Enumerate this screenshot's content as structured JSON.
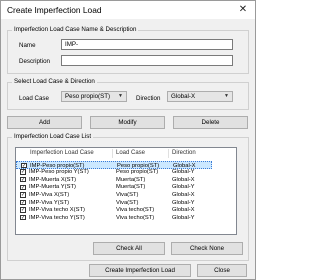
{
  "window": {
    "title": "Create Imperfection Load"
  },
  "name_group": {
    "legend": "Imperfection Load Case Name & Description",
    "name_label": "Name",
    "name_value": "IMP-",
    "description_label": "Description",
    "description_value": ""
  },
  "select_group": {
    "legend": "Select Load Case & Direction",
    "load_case_label": "Load Case",
    "load_case_value": "Peso propio(ST)",
    "direction_label": "Direction",
    "direction_value": "Global-X"
  },
  "actions": {
    "add": "Add",
    "modify": "Modify",
    "delete": "Delete"
  },
  "list_group": {
    "legend": "Imperfection Load Case List",
    "columns": [
      "Imperfection Load Case",
      "Load Case",
      "Direction"
    ],
    "rows": [
      {
        "checked": true,
        "name": "IMP-Peso propio(ST)",
        "load_case": "Peso propio(ST)",
        "direction": "Global-X",
        "selected": true
      },
      {
        "checked": true,
        "name": "IMP-Peso propio Y(ST)",
        "load_case": "Peso propio(ST)",
        "direction": "Global-Y",
        "selected": false
      },
      {
        "checked": true,
        "name": "IMP-Muerta X(ST)",
        "load_case": "Muerta(ST)",
        "direction": "Global-X",
        "selected": false
      },
      {
        "checked": true,
        "name": "IMP-Muerta Y(ST)",
        "load_case": "Muerta(ST)",
        "direction": "Global-Y",
        "selected": false
      },
      {
        "checked": true,
        "name": "IMP-Viva X(ST)",
        "load_case": "Viva(ST)",
        "direction": "Global-X",
        "selected": false
      },
      {
        "checked": true,
        "name": "IMP-Viva Y(ST)",
        "load_case": "Viva(ST)",
        "direction": "Global-Y",
        "selected": false
      },
      {
        "checked": true,
        "name": "IMP-Viva techo X(ST)",
        "load_case": "Viva techo(ST)",
        "direction": "Global-X",
        "selected": false
      },
      {
        "checked": true,
        "name": "IMP-Viva techo Y(ST)",
        "load_case": "Viva techo(ST)",
        "direction": "Global-Y",
        "selected": false
      }
    ],
    "check_all": "Check All",
    "check_none": "Check None"
  },
  "footer": {
    "create": "Create Imperfection Load",
    "close": "Close"
  }
}
